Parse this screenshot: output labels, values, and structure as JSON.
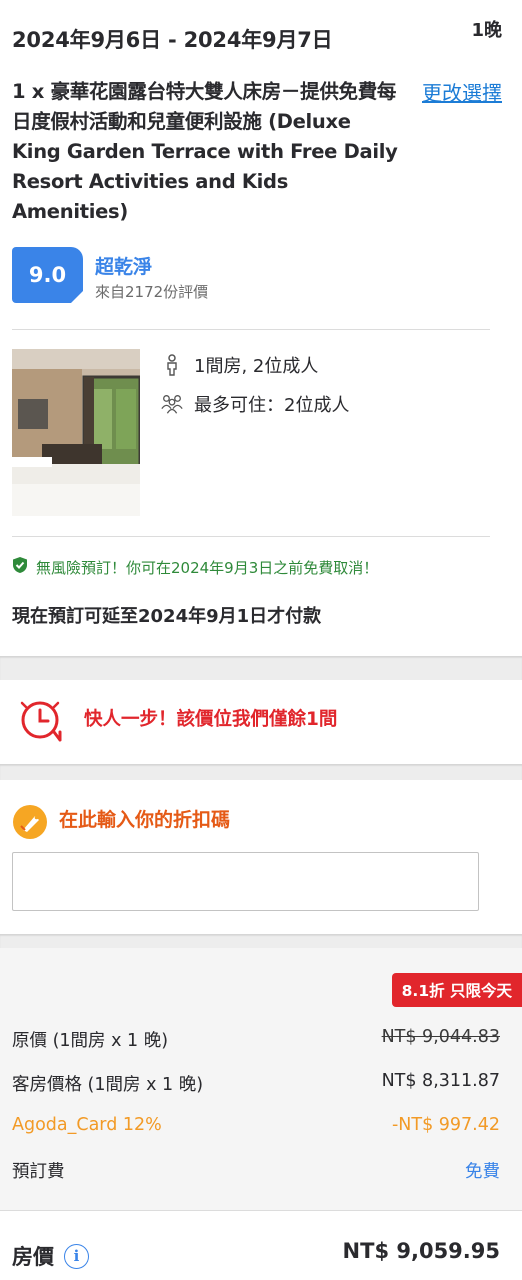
{
  "booking": {
    "dates": "2024年9月6日 - 2024年9月7日",
    "nights": "1晚",
    "room_title": "1 x 豪華花園露台特大雙人床房－提供免費每日度假村活動和兒童便利設施 (Deluxe King Garden Terrace with Free Daily Resort Activities and Kids Amenities)",
    "change_label": "更改選擇"
  },
  "review": {
    "score": "9.0",
    "label": "超乾淨",
    "sub": "來自2172份評價"
  },
  "occupancy": {
    "rooms_guests": "1間房, 2位成人",
    "max_occupancy": "最多可住：2位成人"
  },
  "policy": {
    "free_cancel": "無風險預訂！你可在2024年9月3日之前免費取消！",
    "pay_later": "現在預訂可延至2024年9月1日才付款"
  },
  "urgency": {
    "text": "快人一步！該價位我們僅餘1間"
  },
  "promo": {
    "title": "在此輸入你的折扣碼",
    "placeholder": ""
  },
  "pricing": {
    "deal_tag": "8.1折 只限今天",
    "rows": [
      {
        "label": "原價 (1間房 x 1 晚)",
        "value": "NT$ 9,044.83"
      },
      {
        "label": "客房價格 (1間房 x 1 晚)",
        "value": "NT$ 8,311.87"
      },
      {
        "label": "Agoda_Card 12%",
        "value": "-NT$ 997.42"
      },
      {
        "label": "預訂費",
        "value": "免費"
      }
    ],
    "total_label": "房價",
    "total_value": "NT$ 9,059.95"
  },
  "colors": {
    "accent_blue": "#3a84e8",
    "link_blue": "#1c7cd6",
    "urgent_red": "#e1262c",
    "promo_orange": "#e55a16",
    "agoda_orange": "#f29a26",
    "success_green": "#2f8a3a"
  },
  "icons": {
    "person": "person-icon",
    "group": "group-icon",
    "shield": "shield-check-icon",
    "clock": "clock-alarm-icon",
    "coupon": "coupon-icon",
    "info": "info-icon"
  }
}
